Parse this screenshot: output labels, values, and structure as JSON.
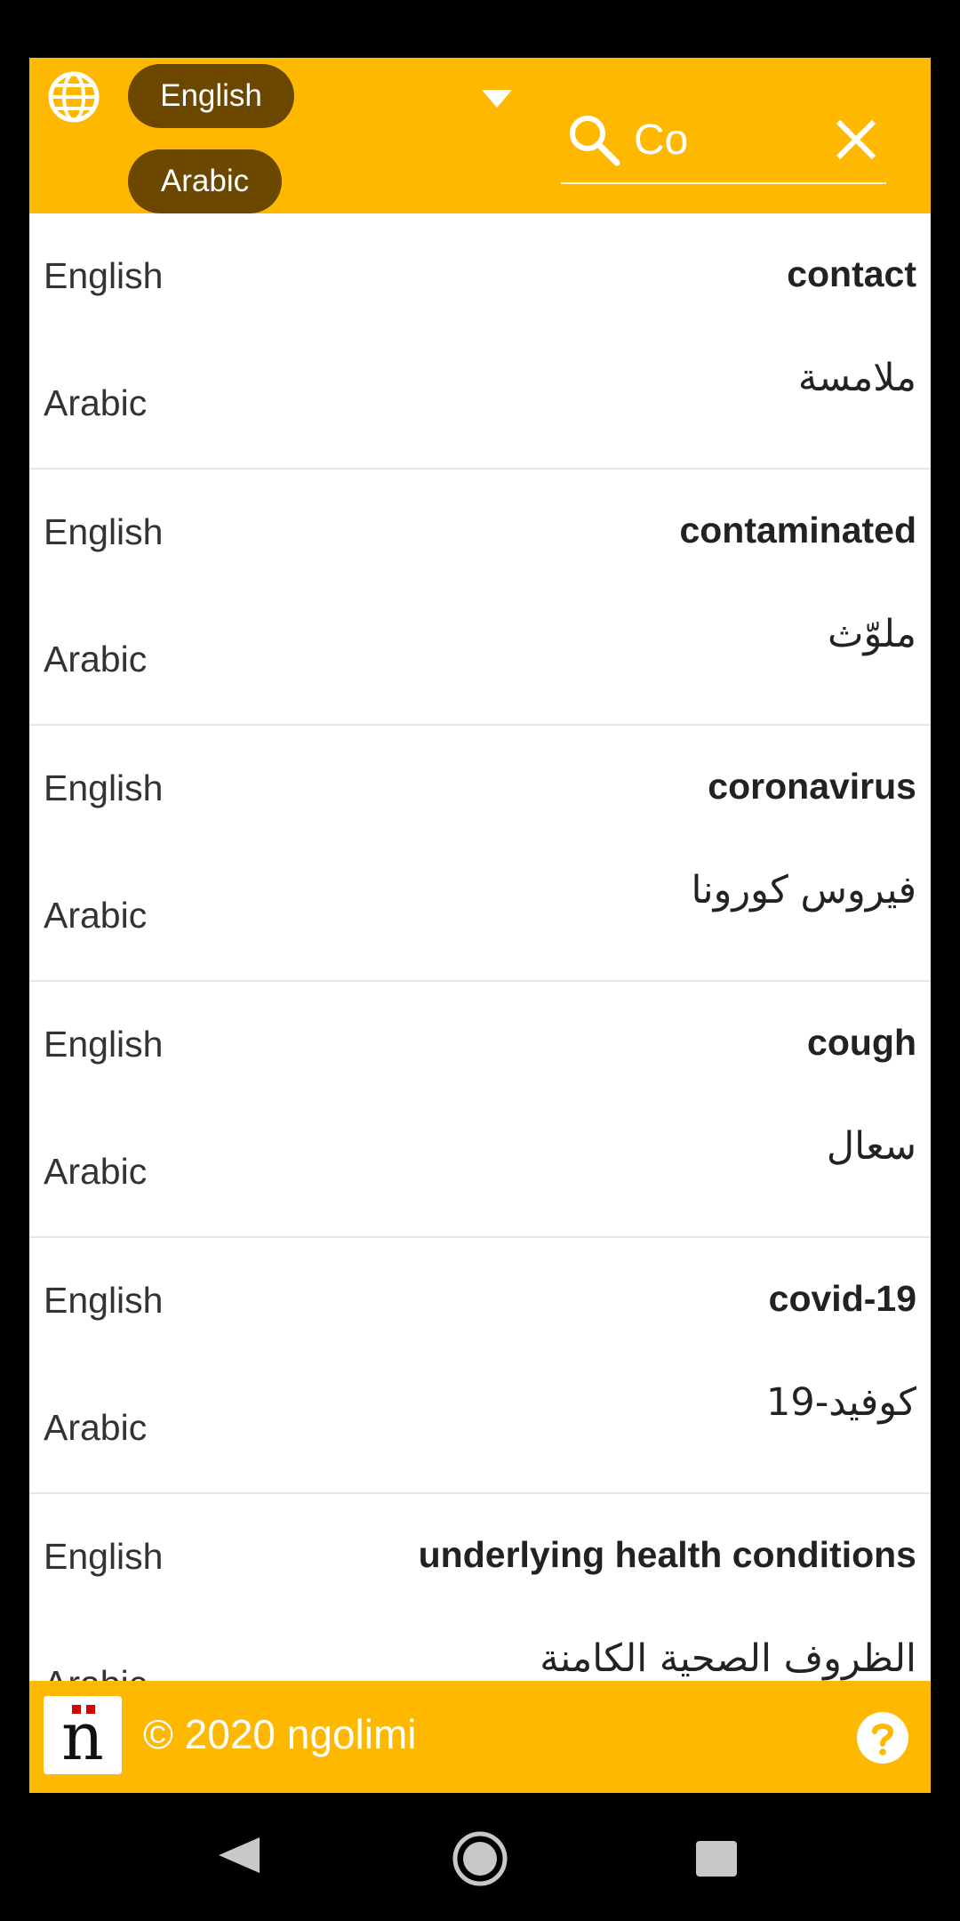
{
  "header": {
    "source_language": "English",
    "target_language": "Arabic",
    "search": {
      "value": "Co",
      "placeholder": ""
    }
  },
  "entries": [
    {
      "source_label": "English",
      "source_term": "contact",
      "target_label": "Arabic",
      "target_term": "ملامسة"
    },
    {
      "source_label": "English",
      "source_term": "contaminated",
      "target_label": "Arabic",
      "target_term": "ملوّث"
    },
    {
      "source_label": "English",
      "source_term": "coronavirus",
      "target_label": "Arabic",
      "target_term": "فيروس كورونا"
    },
    {
      "source_label": "English",
      "source_term": "cough",
      "target_label": "Arabic",
      "target_term": "سعال"
    },
    {
      "source_label": "English",
      "source_term": "covid-19",
      "target_label": "Arabic",
      "target_term": "كوفيد-19"
    },
    {
      "source_label": "English",
      "source_term": "underlying health conditions",
      "target_label": "Arabic",
      "target_term": "الظروف الصحية الكامنة"
    }
  ],
  "footer": {
    "copyright": "© 2020 ngolimi",
    "logo_letter": "n"
  },
  "colors": {
    "accent": "#FFB800",
    "pill": "#6B4700"
  },
  "icons": {
    "globe": "globe-icon",
    "dropdown": "caret-down-icon",
    "search": "search-icon",
    "clear": "close-icon",
    "help": "help-icon",
    "nav_back": "back-icon",
    "nav_home": "home-icon",
    "nav_recent": "recents-icon"
  }
}
